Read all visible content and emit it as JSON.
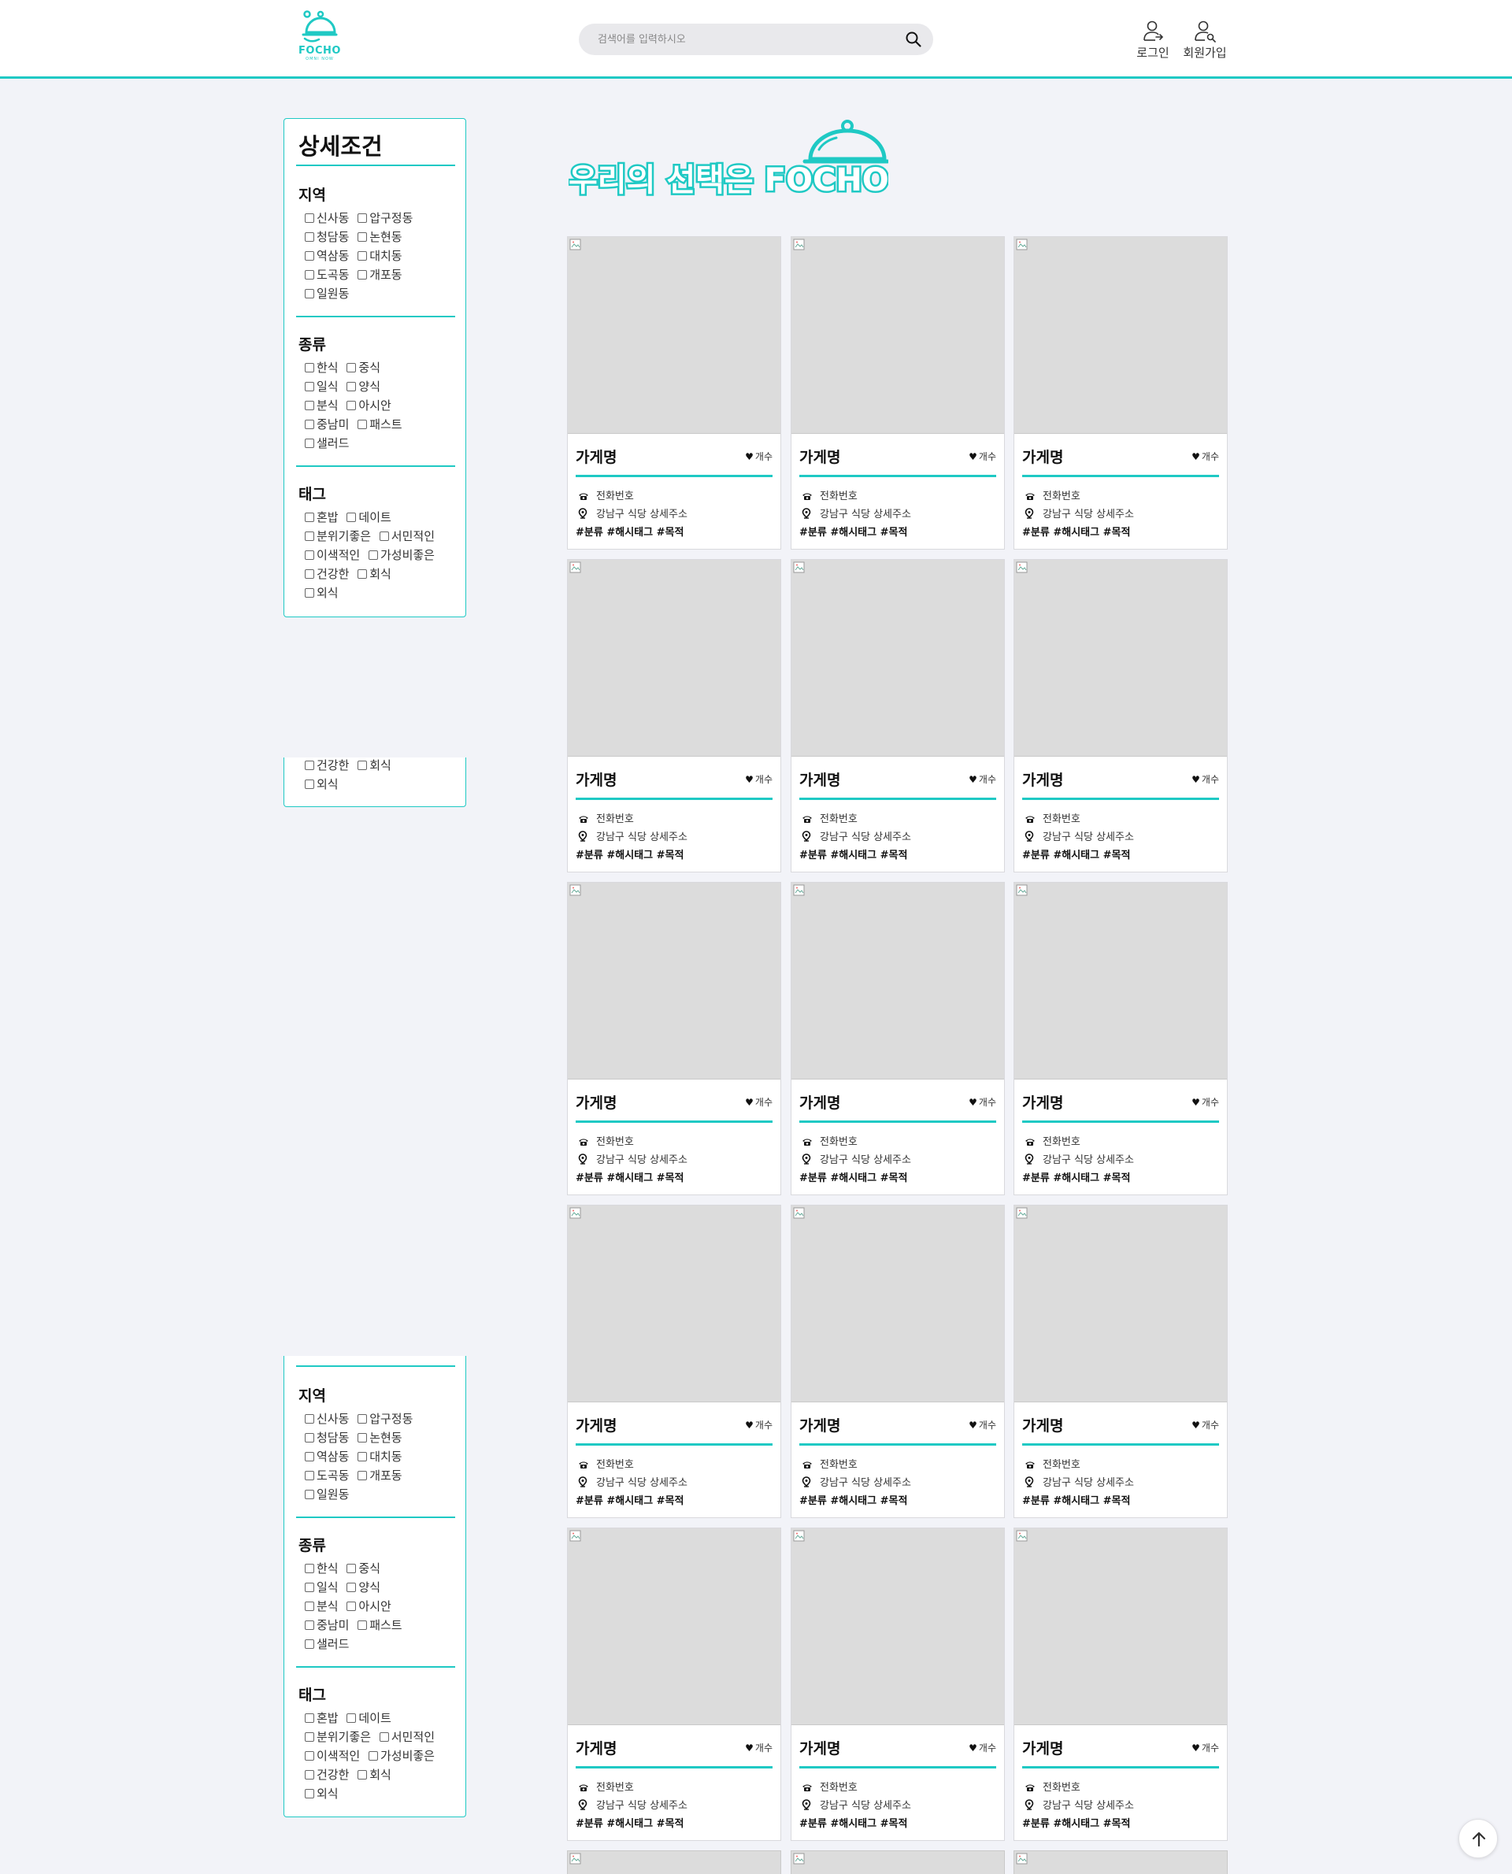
{
  "header": {
    "logo_text": "FOCHO",
    "logo_sub": "OMNI NOW",
    "search_placeholder": "검색어를 입력하시오",
    "login_label": "로그인",
    "signup_label": "회원가입"
  },
  "banner": {
    "text": "우리의 선택은 FOCHO"
  },
  "sidebar": {
    "title": "상세조건",
    "sections": [
      {
        "title": "지역",
        "rows": [
          [
            "신사동",
            "압구정동"
          ],
          [
            "청담동",
            "논현동"
          ],
          [
            "역삼동",
            "대치동"
          ],
          [
            "도곡동",
            "개포동"
          ],
          [
            "일원동"
          ]
        ]
      },
      {
        "title": "종류",
        "rows": [
          [
            "한식",
            "중식"
          ],
          [
            "일식",
            "양식"
          ],
          [
            "분식",
            "아시안"
          ],
          [
            "중남미",
            "패스트"
          ],
          [
            "샐러드"
          ]
        ]
      },
      {
        "title": "태그",
        "rows": [
          [
            "혼밥",
            "데이트"
          ],
          [
            "분위기좋은",
            "서민적인"
          ],
          [
            "이색적인",
            "가성비좋은"
          ],
          [
            "건강한",
            "회식"
          ],
          [
            "외식"
          ]
        ]
      }
    ]
  },
  "card": {
    "name": "가게명",
    "likes_label": "개수",
    "phone": "전화번호",
    "address": "강남구 식당 상세주소",
    "tags": "#분류 #해시태그 #목적"
  },
  "colors": {
    "accent": "#1fc9c4",
    "card_image_bg": "#dcdcdc",
    "page_bg": "#f2f3f8"
  },
  "icons": [
    "search-icon",
    "login-user-icon",
    "signup-user-icon",
    "heart-icon",
    "phone-icon",
    "location-pin-icon",
    "arrow-up-icon",
    "broken-image-icon"
  ]
}
